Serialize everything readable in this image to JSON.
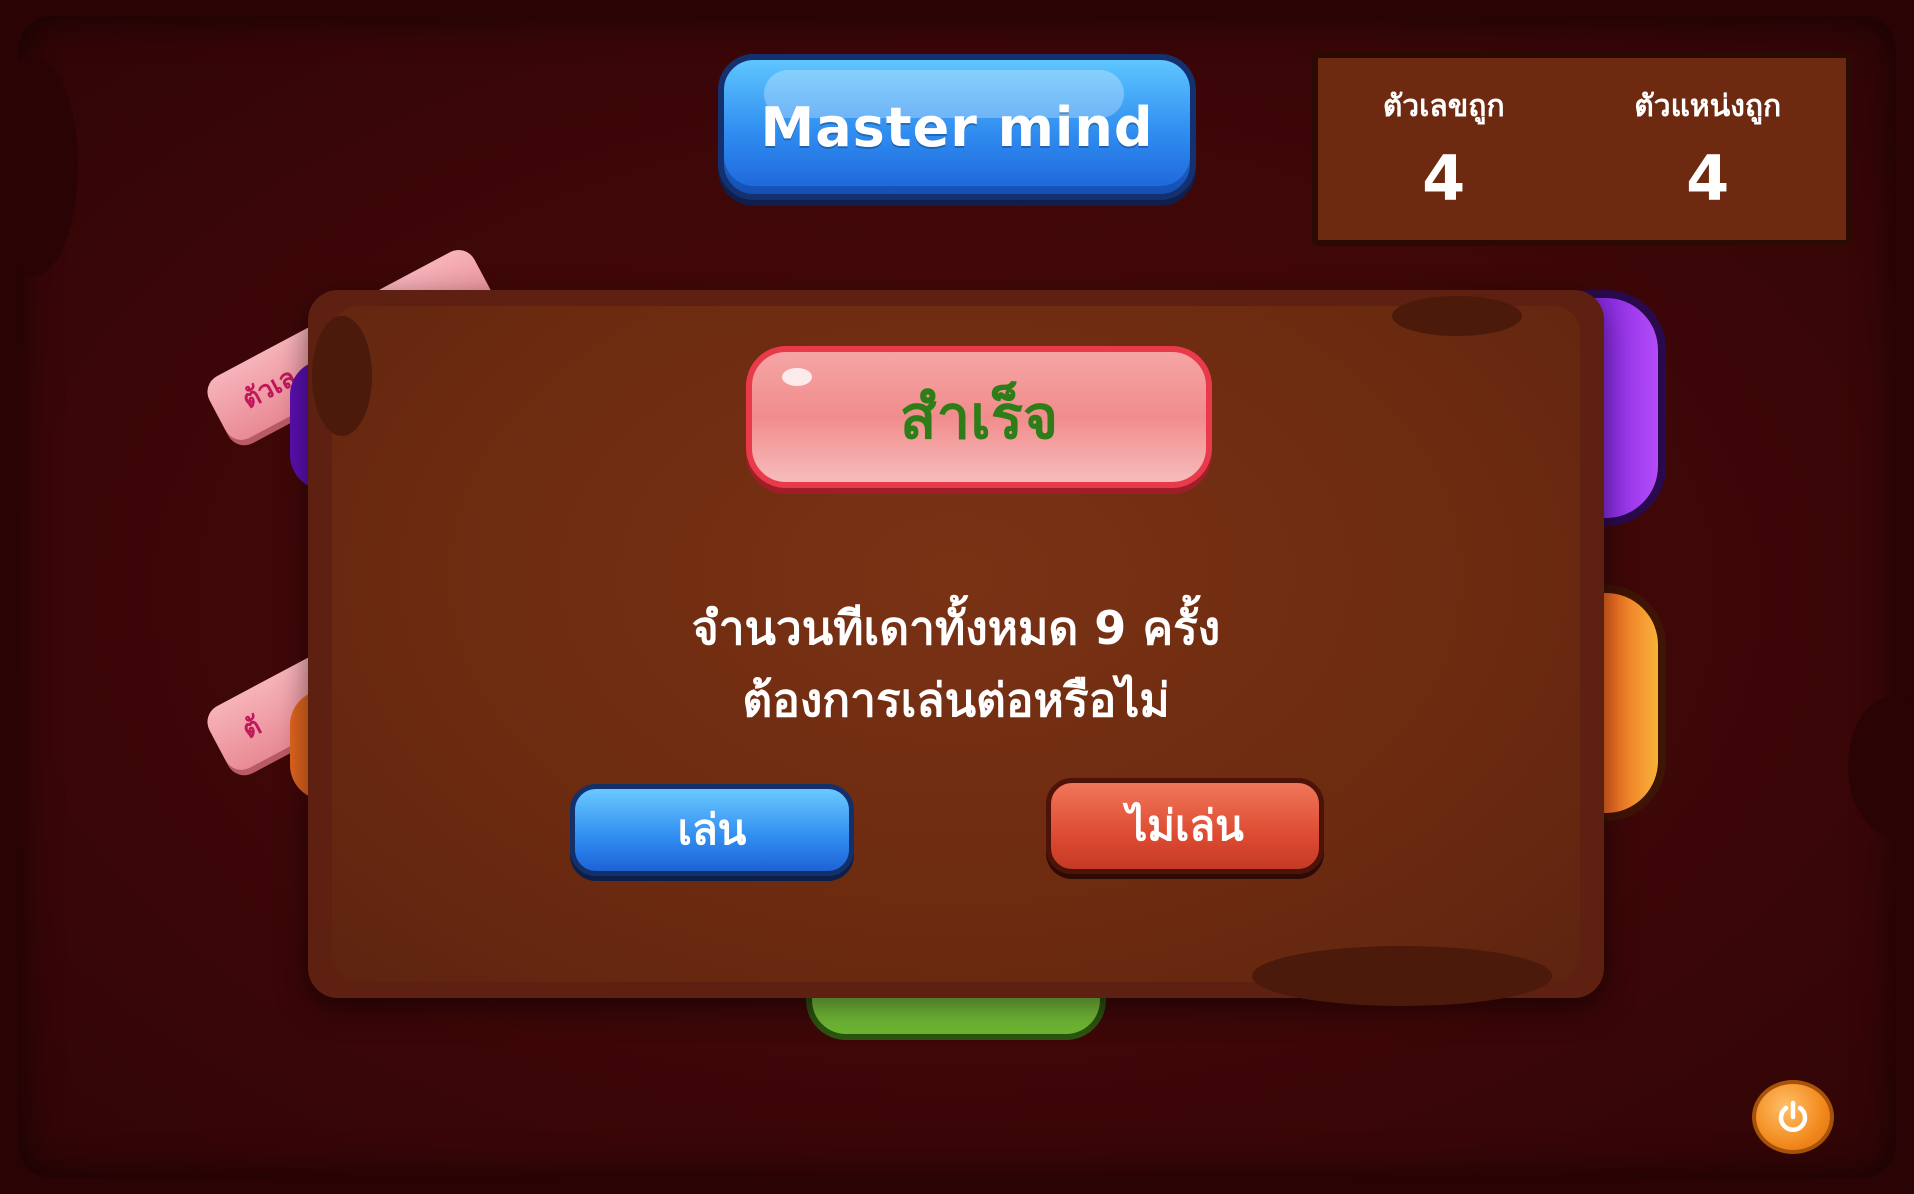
{
  "title": "Master mind",
  "score_panel": {
    "correct_digits_label": "ตัวเลขถูก",
    "correct_digits_value": "4",
    "correct_positions_label": "ตัวแหน่งถูก",
    "correct_positions_value": "4"
  },
  "background": {
    "ribbon_1_text": "ตัวเล",
    "ribbon_2_text": "ตั"
  },
  "modal": {
    "heading": "สำเร็จ",
    "message_line1": "จำนวนทีเดาทั้งหมด 9 ครั้ง",
    "message_line2": "ต้องการเล่นต่อหรือไม่",
    "play_label": "เล่น",
    "quit_label": "ไม่เล่น"
  },
  "icons": {
    "power": "power-icon"
  },
  "colors": {
    "title_blue": "#2f8cf0",
    "success_text": "#2e7d18",
    "quit_red": "#de4b32"
  }
}
